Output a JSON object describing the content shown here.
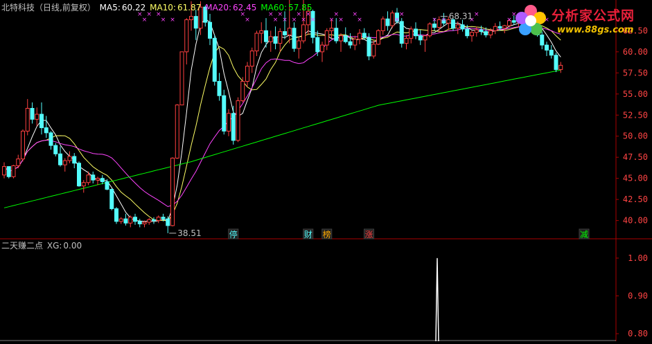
{
  "header": {
    "stock": "北特科技（日线,前复权）",
    "ma5_label": "MA5:",
    "ma5_value": "60.22",
    "ma10_label": "MA10:",
    "ma10_value": "61.87",
    "ma20_label": "MA20:",
    "ma20_value": "62.45",
    "ma60_label": "MA60:",
    "ma60_value": "57.85"
  },
  "sub_header": {
    "indicator": "二天赚二点",
    "xg_label": "XG:",
    "xg_value": "0.00"
  },
  "logo": {
    "name": "分析家公式网",
    "url": "www.88gs.com"
  },
  "colors": {
    "up": "#ff4040",
    "down": "#54fcfc",
    "ma5": "#ffffff",
    "ma10": "#ffff66",
    "ma20": "#ff44ff",
    "ma60": "#00ff00",
    "axis": "#aa0000",
    "grid": "#440000",
    "axis_text": "#ff4444",
    "text": "#c0c0c0",
    "marker": "#ff44ff"
  },
  "chart_data": [
    {
      "type": "candlestick",
      "title": "北特科技（日线,前复权）",
      "ylim": [
        38.0,
        64.5
      ],
      "y_ticks": [
        "40.00",
        "42.50",
        "45.00",
        "47.50",
        "50.00",
        "52.50",
        "55.00",
        "57.50",
        "60.00",
        "62.50"
      ],
      "annotations": [
        {
          "text": "68.31",
          "index": 93
        },
        {
          "text": "38.51",
          "index": 35
        }
      ],
      "event_tags": [
        {
          "text": "停",
          "index": 49,
          "color": "#54fcfc"
        },
        {
          "text": "财",
          "index": 65,
          "color": "#54fcfc"
        },
        {
          "text": "榜",
          "index": 69,
          "color": "#ffaa00"
        },
        {
          "text": "涨",
          "index": 78,
          "color": "#ff4040"
        },
        {
          "text": "减",
          "index": 124,
          "color": "#00ff00"
        }
      ],
      "candles": [
        [
          45.4,
          46.9,
          45.0,
          46.4
        ],
        [
          46.4,
          46.4,
          45.0,
          45.2
        ],
        [
          45.2,
          46.6,
          45.0,
          46.5
        ],
        [
          46.5,
          47.8,
          46.2,
          47.3
        ],
        [
          47.3,
          50.8,
          47.0,
          50.6
        ],
        [
          50.6,
          54.4,
          50.1,
          53.3
        ],
        [
          53.3,
          54.0,
          51.5,
          52.0
        ],
        [
          52.0,
          53.4,
          51.2,
          52.6
        ],
        [
          52.6,
          54.0,
          50.2,
          51.0
        ],
        [
          51.0,
          52.4,
          49.8,
          50.4
        ],
        [
          50.4,
          50.6,
          48.4,
          48.9
        ],
        [
          48.9,
          49.2,
          47.6,
          47.9
        ],
        [
          47.9,
          48.8,
          46.4,
          46.6
        ],
        [
          46.6,
          47.4,
          45.8,
          47.1
        ],
        [
          47.1,
          48.2,
          46.8,
          47.6
        ],
        [
          47.6,
          48.0,
          46.2,
          46.8
        ],
        [
          46.8,
          47.0,
          44.0,
          44.1
        ],
        [
          44.1,
          44.8,
          43.3,
          44.5
        ],
        [
          44.5,
          45.8,
          44.2,
          45.4
        ],
        [
          45.4,
          45.8,
          44.4,
          44.8
        ],
        [
          44.8,
          45.2,
          44.2,
          45.0
        ],
        [
          45.0,
          45.4,
          44.3,
          44.6
        ],
        [
          44.6,
          44.9,
          43.6,
          43.7
        ],
        [
          43.7,
          43.8,
          41.2,
          41.4
        ],
        [
          41.4,
          41.6,
          39.6,
          39.9
        ],
        [
          39.9,
          40.4,
          39.6,
          40.2
        ],
        [
          40.2,
          40.8,
          39.4,
          39.7
        ],
        [
          39.7,
          40.6,
          39.2,
          40.4
        ],
        [
          40.4,
          40.8,
          39.5,
          39.9
        ],
        [
          39.9,
          40.2,
          39.2,
          39.6
        ],
        [
          39.6,
          40.0,
          39.2,
          39.8
        ],
        [
          39.8,
          40.3,
          39.5,
          40.1
        ],
        [
          40.1,
          40.4,
          39.6,
          40.0
        ],
        [
          40.0,
          40.6,
          39.7,
          40.4
        ],
        [
          40.4,
          40.8,
          39.9,
          40.2
        ],
        [
          40.2,
          40.5,
          38.5,
          39.4
        ],
        [
          39.4,
          47.5,
          39.3,
          47.4
        ],
        [
          47.4,
          53.8,
          47.3,
          53.7
        ],
        [
          53.7,
          60.0,
          53.7,
          60.0
        ],
        [
          60.0,
          64.0,
          58.5,
          63.8
        ],
        [
          63.8,
          66.0,
          62.5,
          64.2
        ],
        [
          64.2,
          65.0,
          61.4,
          62.8
        ],
        [
          62.8,
          66.0,
          62.0,
          65.3
        ],
        [
          65.3,
          65.5,
          63.0,
          63.5
        ],
        [
          63.5,
          64.5,
          60.8,
          61.6
        ],
        [
          61.6,
          62.0,
          56.0,
          56.5
        ],
        [
          56.5,
          57.5,
          54.2,
          54.8
        ],
        [
          54.8,
          55.5,
          50.2,
          50.6
        ],
        [
          50.6,
          53.2,
          50.0,
          52.7
        ],
        [
          52.7,
          53.6,
          49.0,
          49.5
        ],
        [
          49.5,
          54.6,
          49.3,
          54.2
        ],
        [
          54.2,
          57.0,
          54.0,
          56.5
        ],
        [
          56.5,
          58.8,
          55.8,
          58.3
        ],
        [
          58.3,
          60.5,
          57.5,
          60.1
        ],
        [
          60.1,
          62.5,
          59.5,
          62.2
        ],
        [
          62.2,
          63.5,
          61.0,
          62.5
        ],
        [
          62.5,
          64.0,
          60.5,
          61.2
        ],
        [
          61.2,
          62.5,
          60.0,
          61.8
        ],
        [
          61.8,
          63.0,
          60.3,
          61.0
        ],
        [
          61.0,
          62.8,
          60.0,
          62.4
        ],
        [
          62.4,
          64.8,
          61.5,
          62.0
        ],
        [
          62.0,
          66.5,
          61.0,
          62.8
        ],
        [
          62.8,
          63.5,
          60.0,
          60.4
        ],
        [
          60.4,
          61.8,
          59.2,
          61.3
        ],
        [
          61.3,
          68.3,
          61.0,
          63.2
        ],
        [
          63.2,
          65.5,
          62.0,
          64.8
        ],
        [
          64.8,
          65.0,
          61.0,
          61.7
        ],
        [
          61.7,
          62.5,
          59.5,
          60.0
        ],
        [
          60.0,
          61.2,
          58.8,
          60.8
        ],
        [
          60.8,
          62.8,
          60.2,
          62.5
        ],
        [
          62.5,
          63.8,
          61.6,
          62.8
        ],
        [
          62.8,
          64.0,
          61.0,
          61.3
        ],
        [
          61.3,
          62.2,
          60.0,
          61.9
        ],
        [
          61.9,
          62.9,
          61.0,
          61.2
        ],
        [
          61.2,
          62.2,
          60.4,
          60.8
        ],
        [
          60.8,
          61.9,
          60.2,
          61.5
        ],
        [
          61.5,
          62.7,
          60.9,
          62.2
        ],
        [
          62.2,
          62.8,
          61.5,
          61.7
        ],
        [
          61.7,
          62.2,
          59.0,
          59.5
        ],
        [
          59.5,
          61.3,
          59.2,
          60.9
        ],
        [
          60.9,
          62.7,
          60.8,
          62.5
        ],
        [
          62.5,
          64.2,
          62.0,
          63.9
        ],
        [
          63.9,
          64.8,
          62.5,
          63.1
        ],
        [
          63.1,
          64.9,
          62.8,
          64.6
        ],
        [
          64.6,
          65.2,
          63.3,
          63.6
        ],
        [
          63.6,
          64.0,
          60.5,
          61.0
        ],
        [
          61.0,
          62.0,
          60.3,
          61.6
        ],
        [
          61.6,
          63.0,
          61.0,
          62.7
        ],
        [
          62.7,
          63.5,
          61.5,
          61.9
        ],
        [
          61.9,
          62.6,
          60.8,
          61.4
        ],
        [
          61.4,
          62.0,
          60.0,
          61.9
        ],
        [
          61.9,
          63.5,
          61.7,
          63.3
        ],
        [
          63.3,
          64.0,
          62.5,
          62.9
        ],
        [
          62.9,
          64.2,
          62.3,
          63.8
        ],
        [
          63.8,
          64.6,
          63.1,
          63.4
        ],
        [
          63.4,
          64.2,
          62.6,
          63.8
        ],
        [
          63.8,
          64.0,
          62.5,
          62.8
        ],
        [
          62.8,
          63.6,
          62.1,
          63.2
        ],
        [
          63.2,
          63.8,
          62.4,
          62.7
        ],
        [
          62.7,
          63.2,
          61.6,
          61.9
        ],
        [
          61.9,
          62.5,
          61.2,
          62.3
        ],
        [
          62.3,
          63.0,
          61.8,
          62.6
        ],
        [
          62.6,
          63.1,
          62.0,
          62.4
        ],
        [
          62.4,
          62.9,
          61.7,
          62.0
        ],
        [
          62.0,
          62.8,
          61.6,
          62.5
        ],
        [
          62.5,
          63.4,
          62.1,
          63.0
        ],
        [
          63.0,
          63.6,
          62.5,
          62.8
        ],
        [
          62.8,
          63.2,
          62.2,
          63.1
        ],
        [
          63.1,
          63.9,
          62.9,
          63.7
        ],
        [
          63.7,
          64.3,
          63.2,
          63.5
        ],
        [
          63.5,
          64.0,
          63.0,
          63.8
        ],
        [
          63.8,
          64.5,
          63.4,
          64.1
        ],
        [
          64.1,
          64.6,
          63.6,
          63.9
        ],
        [
          63.9,
          64.2,
          62.8,
          63.1
        ],
        [
          63.1,
          63.5,
          61.8,
          62.0
        ],
        [
          62.0,
          62.4,
          60.3,
          60.8
        ],
        [
          60.8,
          61.2,
          59.5,
          60.2
        ],
        [
          60.2,
          60.8,
          59.2,
          59.6
        ],
        [
          59.6,
          59.9,
          57.6,
          57.9
        ],
        [
          57.9,
          58.8,
          57.5,
          58.4
        ]
      ]
    },
    {
      "type": "line",
      "title": "二天赚二点",
      "ylim": [
        0.78,
        1.02
      ],
      "y_ticks": [
        "1.00",
        "0.90",
        "0.80"
      ],
      "series": [
        {
          "name": "XG",
          "spike_index": 92,
          "values_note_hidden": true
        }
      ]
    }
  ]
}
